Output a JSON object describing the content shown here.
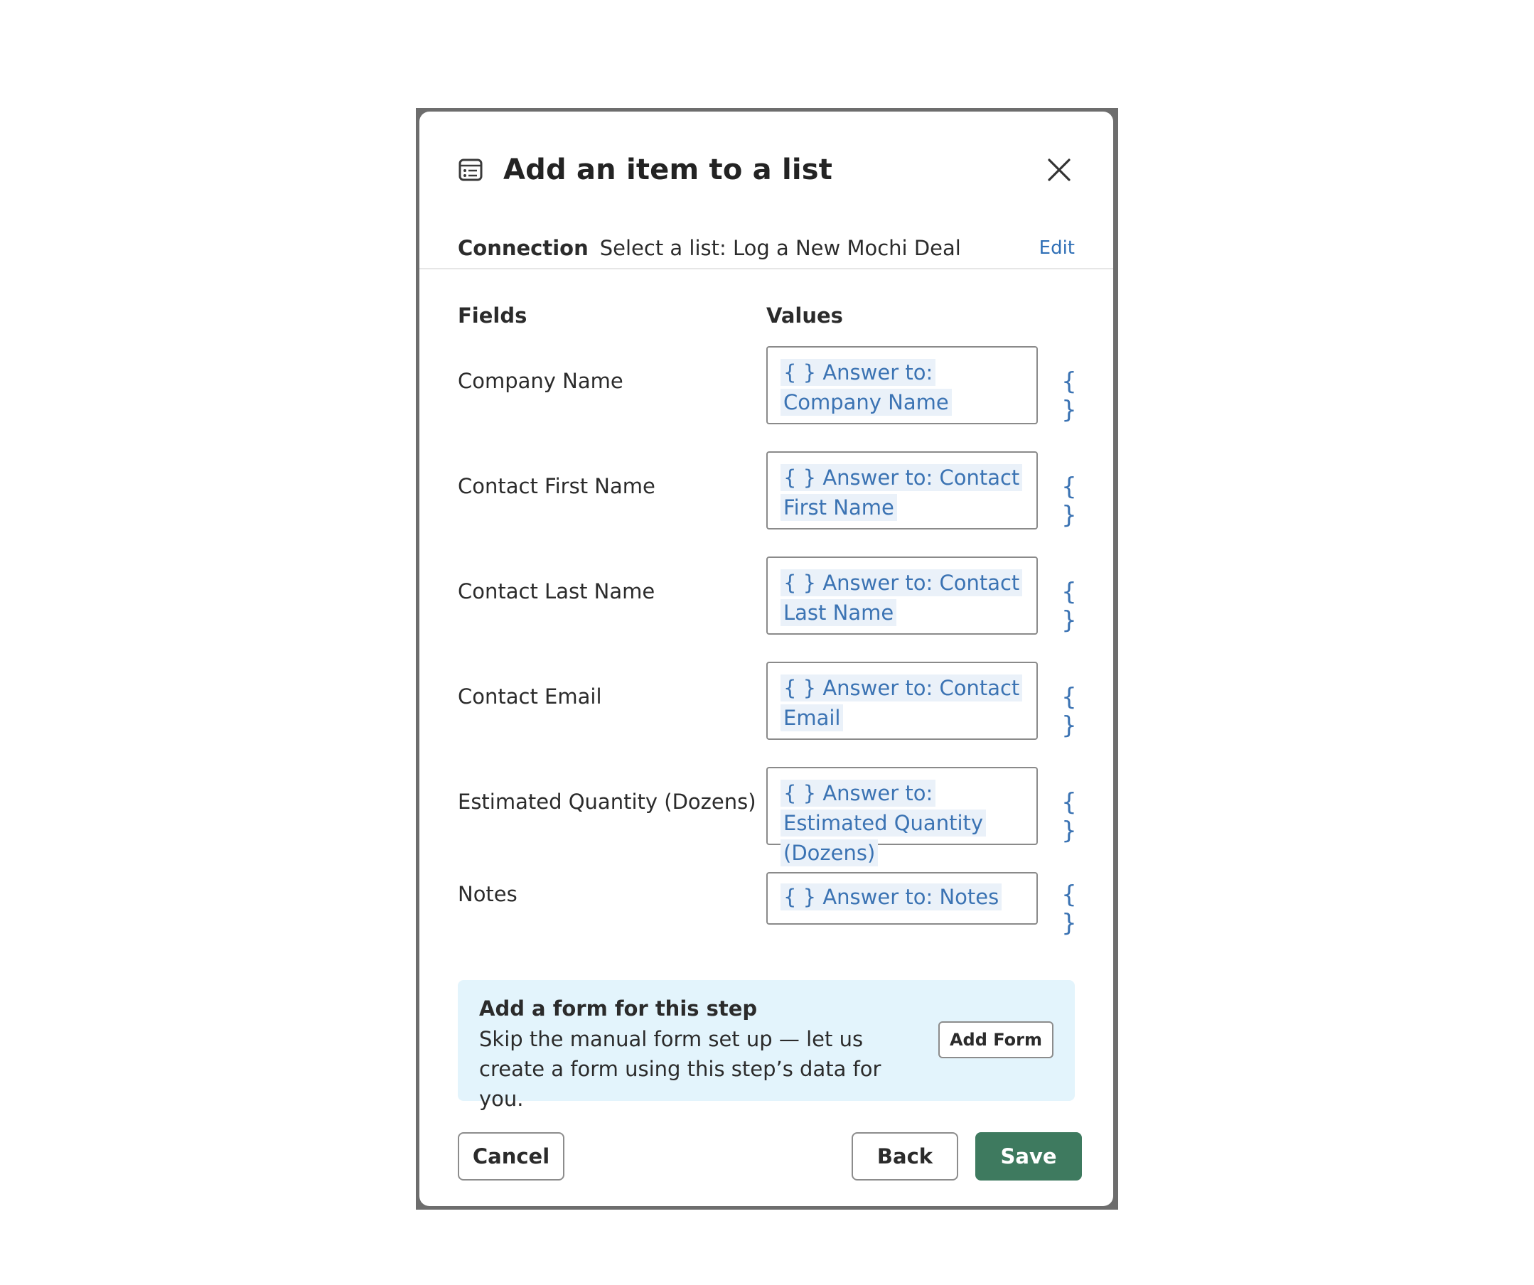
{
  "dialog": {
    "title": "Add an item to a list",
    "icon": "list-icon",
    "close_icon": "close-icon"
  },
  "connection": {
    "label": "Connection",
    "value": "Select a list: Log a New Mochi Deal",
    "edit_label": "Edit"
  },
  "columns": {
    "fields": "Fields",
    "values": "Values"
  },
  "fields": [
    {
      "label": "Company Name",
      "value": "{ } Answer to: Company Name"
    },
    {
      "label": "Contact First Name",
      "value": "{ } Answer to: Contact First Name"
    },
    {
      "label": "Contact Last Name",
      "value": "{ } Answer to: Contact Last Name"
    },
    {
      "label": "Contact Email",
      "value": "{ } Answer to: Contact Email"
    },
    {
      "label": "Estimated Quantity (Dozens)",
      "value": "{ } Answer to: Estimated Quantity (Dozens)"
    },
    {
      "label": "Notes",
      "value": "{ } Answer to: Notes"
    }
  ],
  "variable_button": "{ }",
  "promo": {
    "title": "Add a form for this step",
    "description": "Skip the manual form set up — let us create a form using this step’s data for you.",
    "button_label": "Add Form"
  },
  "footer": {
    "cancel_label": "Cancel",
    "back_label": "Back",
    "save_label": "Save"
  },
  "colors": {
    "accent_link": "#2f6fb6",
    "token_bg": "#eaf1f9",
    "promo_bg": "#e3f4fc",
    "save_bg": "#3e7a5f"
  }
}
